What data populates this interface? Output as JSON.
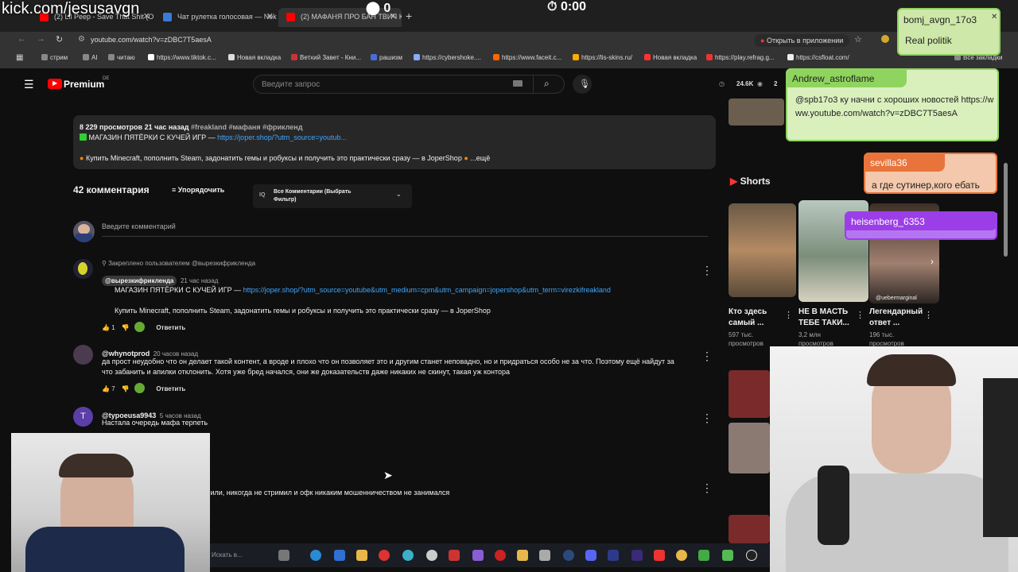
{
  "overlay": {
    "kick_url": "kick.com/jesusavgn",
    "counter": "0",
    "timer": "0:00"
  },
  "tabs": [
    {
      "label": "(2) Lil Peep - Save That Shit (O",
      "color": "#f00",
      "active": false
    },
    {
      "label": "Чат рулетка голосовая — Nek",
      "color": "#3a7bd5",
      "active": false
    },
    {
      "label": "(2) МАФАНЯ ПРО БАН ТВИЧ К",
      "color": "#f00",
      "active": true
    }
  ],
  "address": {
    "url": "youtube.com/watch?v=zDBC7T5aesA",
    "open_in_app": "Открыть в приложении"
  },
  "bookmarks": [
    {
      "label": "стрим",
      "color": "#aaa"
    },
    {
      "label": "AI",
      "color": "#aaa"
    },
    {
      "label": "читаю",
      "color": "#aaa"
    },
    {
      "label": "https://www.tiktok.c...",
      "color": "#fff"
    },
    {
      "label": "Новая вкладка",
      "color": "#ddd"
    },
    {
      "label": "Ветхий Завет - Кни...",
      "color": "#c33"
    },
    {
      "label": "рашизм",
      "color": "#4b6cd8"
    },
    {
      "label": "https://cybershoke....",
      "color": "#8af"
    },
    {
      "label": "https://www.faceit.c...",
      "color": "#f60"
    },
    {
      "label": "https://lis-skins.ru/",
      "color": "#fa0"
    },
    {
      "label": "Новая вкладка",
      "color": "#f33"
    },
    {
      "label": "https://play.refrag.g...",
      "color": "#e33"
    },
    {
      "label": "https://csfloat.com/",
      "color": "#eee"
    }
  ],
  "bookmarks_all": "Все закладки",
  "youtube": {
    "logo": "Premium",
    "region": "DE",
    "search_placeholder": "Введите запрос",
    "viewers": "24.6K",
    "viewers2": "2"
  },
  "description": {
    "meta": "8 229 просмотров  21 час назад",
    "tags": "#freakland #мафаня #фрикленд",
    "line1_text": "МАГАЗИН ПЯТЁРКИ С КУЧЕЙ ИГР — ",
    "line1_link": "https://joper.shop/?utm_source=youtub...",
    "line2": "Купить Minecraft, пополнить Steam, задонатить гемы и робуксы и получить это практически сразу — в JoperShop",
    "more": "...ещё"
  },
  "comments_header": {
    "count": "42 комментария",
    "sort": "Упорядочить",
    "filter": "Все Комментарии (Выбрать Фильтр)",
    "input_placeholder": "Введите комментарий"
  },
  "comments": [
    {
      "pinned": "Закреплено пользователем @вырезкифрикленда",
      "author": "@вырезкифрикленда",
      "time": "21 час назад",
      "text1": "МАГАЗИН ПЯТЁРКИ С КУЧЕЙ ИГР — ",
      "link": "https://joper.shop/?utm_source=youtube&utm_medium=cpm&utm_campaign=jopershop&utm_term=virezkifreakland",
      "text2": "Купить Minecraft, пополнить Steam, задонатить гемы и робуксы и получить это практически сразу — в JoperShop",
      "likes": "1",
      "reply": "Ответить"
    },
    {
      "author": "@whynotprod",
      "time": "20 часов назад",
      "text1": "да прост неудобно что он делает такой контент, а вроде и плохо что он позволяет это и другим станет неповадно, но и придраться особо не за что. Поэтому ещё найдут за",
      "text2": "что забанить и апилки отклонить. Хотя уже бред начался, они же доказательств даже никаких не скинут, такая уж контора",
      "likes": "7",
      "reply": "Ответить"
    },
    {
      "author": "@typoeusa9943",
      "time": "5 часов назад",
      "text1": "Настала очередь мафа терпеть"
    },
    {
      "text1": "...нили, никогда не стримил и офк никаким мошенничеством не занимался"
    }
  ],
  "sidebar": {
    "shorts_title": "Shorts",
    "shorts": [
      {
        "title": "Кто здесь самый ...",
        "views": "597 тыс. просмотров"
      },
      {
        "title": "НЕ В МАСТЬ ТЕБЕ ТАКИ...",
        "views": "3,2 млн просмотров"
      },
      {
        "title": "Легендарный ответ ...",
        "views": "196 тыс. просмотров",
        "handle": "@uebermarginal"
      }
    ]
  },
  "chat": [
    {
      "user": "bomj_avgn_17o3",
      "message": "Real politik",
      "color": "#8fd45e"
    },
    {
      "user": "Andrew_astroflame",
      "message": "@spb17o3 ку начни с хороших новостей https://www.youtube.com/watch?v=zDBC7T5aesA",
      "color": "#8fd45e"
    },
    {
      "user": "sevilla36",
      "message": "а где сутинер,кого ебать",
      "color": "#e8743b"
    },
    {
      "user": "heisenberg_6353",
      "message": "",
      "color": "#9b3ee8"
    }
  ],
  "taskbar": {
    "search_placeholder": "Искать в..."
  }
}
